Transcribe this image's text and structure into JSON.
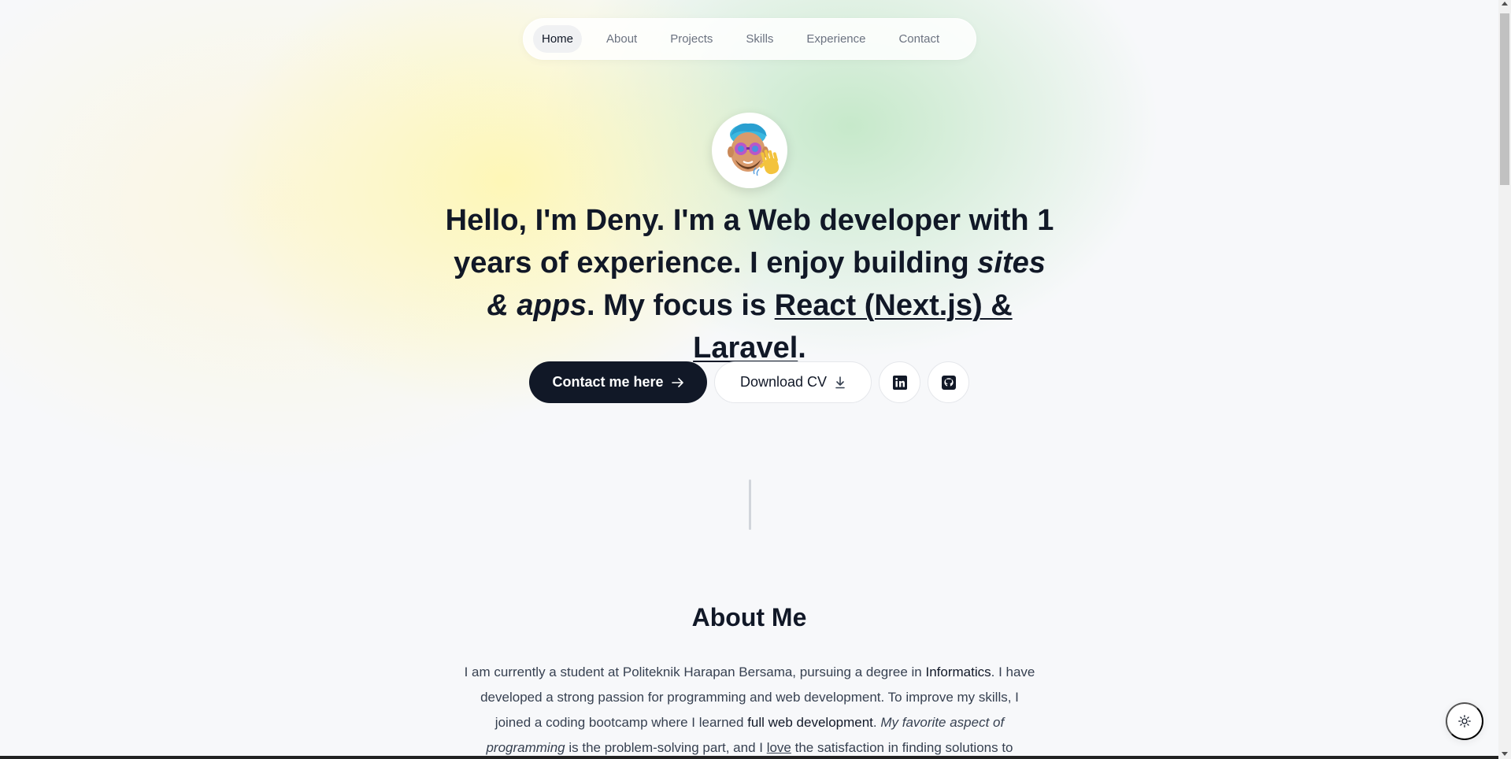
{
  "nav": {
    "items": [
      {
        "label": "Home",
        "active": true
      },
      {
        "label": "About"
      },
      {
        "label": "Projects"
      },
      {
        "label": "Skills"
      },
      {
        "label": "Experience"
      },
      {
        "label": "Contact"
      }
    ]
  },
  "hero": {
    "greeting": "Hello, I'm Deny.",
    "t1": " I'm a ",
    "role": "Web developer",
    "t2": " with ",
    "years": "1 years",
    "t3": " of experience. I enjoy building ",
    "build": "sites & apps",
    "t4": ". My focus is ",
    "focus": "React (Next.js) & Laravel",
    "t5": "."
  },
  "buttons": {
    "contact_label": "Contact me here",
    "cv_label": "Download CV",
    "linkedin_icon": "linkedin-icon",
    "github_icon": "github-icon"
  },
  "about": {
    "title": "About Me",
    "p1": "I am currently a student at Politeknik Harapan Bersama, pursuing a degree in ",
    "degree": "Informatics",
    "p2": ". I have developed a strong passion for programming and web development. To improve my skills, I joined a coding bootcamp where I learned ",
    "learned": "full web development",
    "p3": ". ",
    "favorite": "My favorite aspect of programming",
    "p4": " is the problem-solving part, and I ",
    "love": "love",
    "p5": " the satisfaction in finding solutions to"
  },
  "theme_toggle_icon": "sun-icon",
  "colors": {
    "primary": "#111827",
    "background": "#f7f8fa"
  }
}
